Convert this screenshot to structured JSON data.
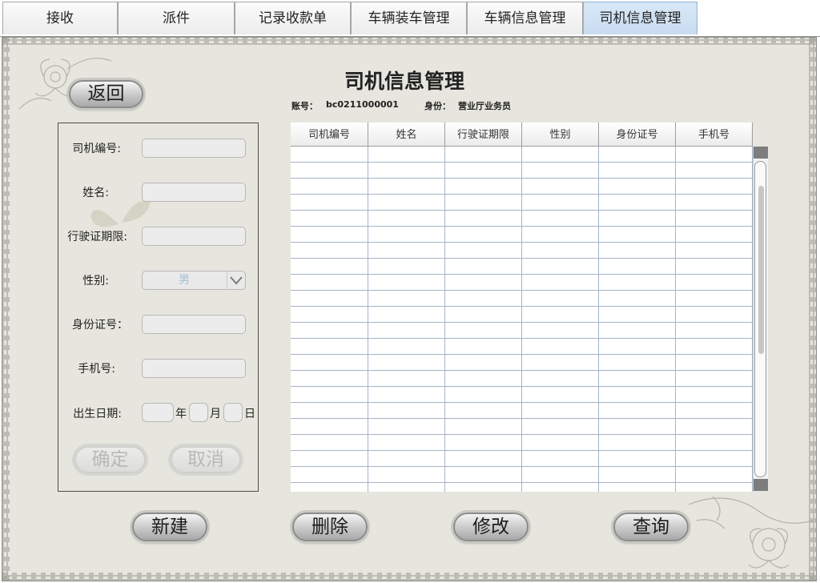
{
  "tabs": [
    {
      "label": "接收"
    },
    {
      "label": "派件"
    },
    {
      "label": "记录收款单"
    },
    {
      "label": "车辆装车管理"
    },
    {
      "label": "车辆信息管理"
    },
    {
      "label": "司机信息管理",
      "active": true
    }
  ],
  "back_button": "返回",
  "page_title": "司机信息管理",
  "account": {
    "label": "账号：",
    "value": "bc0211000001"
  },
  "identity": {
    "label": "身份：",
    "value": "营业厅业务员"
  },
  "form": {
    "driver_id_label": "司机编号:",
    "name_label": "姓名:",
    "license_label": "行驶证期限:",
    "gender_label": "性别:",
    "gender_value": "男",
    "idcard_label": "身份证号：",
    "phone_label": "手机号:",
    "birth_label": "出生日期:",
    "year_label": "年",
    "month_label": "月",
    "day_label": "日",
    "confirm_button": "确定",
    "cancel_button": "取消"
  },
  "table": {
    "columns": [
      "司机编号",
      "姓名",
      "行驶证期限",
      "性别",
      "身份证号",
      "手机号"
    ],
    "rows": []
  },
  "actions": {
    "new_button": "新建",
    "delete_button": "删除",
    "modify_button": "修改",
    "query_button": "查询"
  },
  "colors": {
    "panel_bg": "#e7e6de",
    "active_tab": "#c8dcf0",
    "grid_line": "#a5b4c6"
  }
}
